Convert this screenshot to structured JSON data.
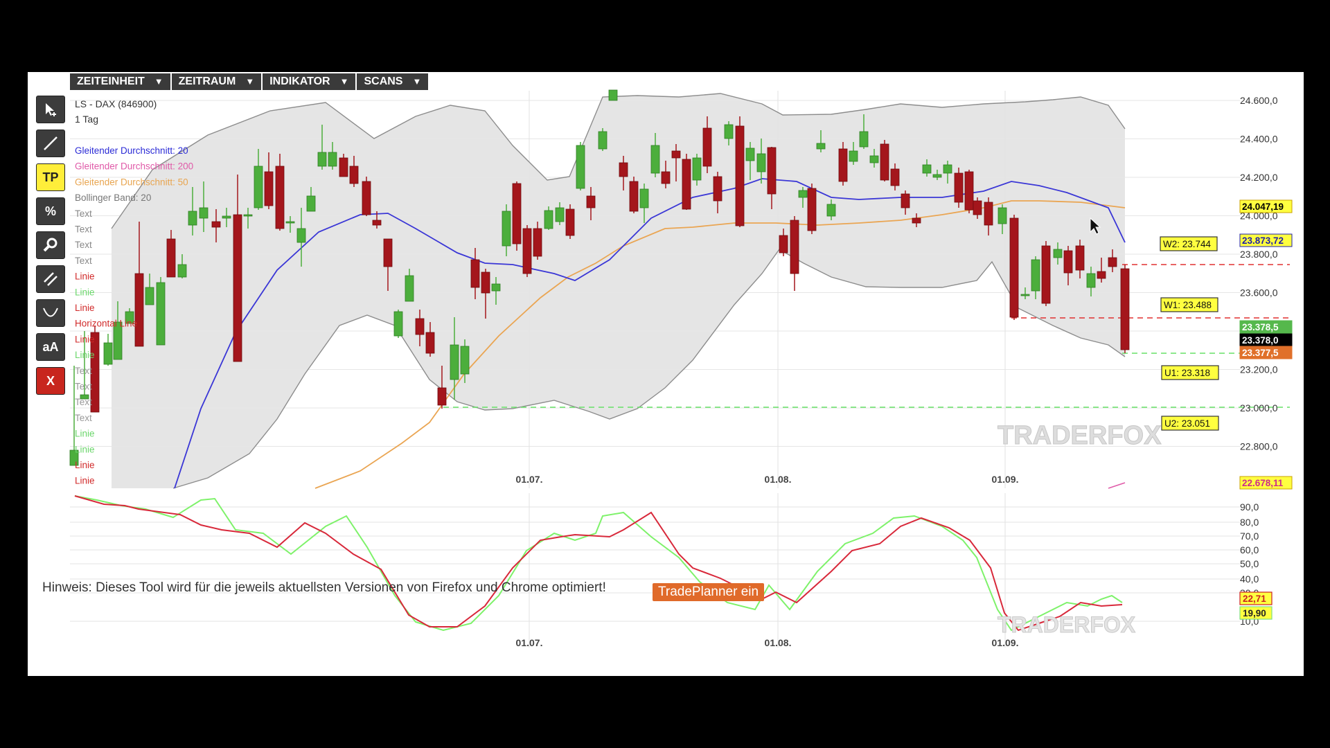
{
  "menu": [
    {
      "label": "ZEITEINHEIT"
    },
    {
      "label": "ZEITRAUM"
    },
    {
      "label": "INDIKATOR"
    },
    {
      "label": "SCANS"
    }
  ],
  "menu_arrow": "▼",
  "tools": {
    "pointer_icon": "cursor-arrow-icon",
    "line_icon": "trend-line-icon",
    "tp_label": "TP",
    "percent_label": "%",
    "zoom_icon": "magnifier-icon",
    "channel_icon": "parallel-lines-icon",
    "arc_icon": "arc-icon",
    "text_label": "aA",
    "close_label": "X"
  },
  "chart": {
    "instrument": "LS - DAX (846900)",
    "timeframe": "1 Tag",
    "legend": [
      {
        "text": "Gleitender Durchschnitt: 20",
        "color": "#2b2bd6"
      },
      {
        "text": "Gleitender Durchschnitt: 200",
        "color": "#e05aa8"
      },
      {
        "text": "Gleitender Durchschnitt: 50",
        "color": "#e8a550"
      },
      {
        "text": "Bollinger Band: 20",
        "color": "#777777"
      },
      {
        "text": "Text",
        "color": "#888888"
      },
      {
        "text": "Text",
        "color": "#888888"
      },
      {
        "text": "Text",
        "color": "#888888"
      },
      {
        "text": "Text",
        "color": "#888888"
      },
      {
        "text": "Linie",
        "color": "#d12a2a"
      },
      {
        "text": "Linie",
        "color": "#6bd66b"
      },
      {
        "text": "Linie",
        "color": "#d12a2a"
      },
      {
        "text": "Horizontal Line",
        "color": "#d12a2a"
      },
      {
        "text": "Linie",
        "color": "#d12a2a"
      },
      {
        "text": "Linie",
        "color": "#6bd66b"
      },
      {
        "text": "Text",
        "color": "#999999"
      },
      {
        "text": "Text",
        "color": "#999999"
      },
      {
        "text": "Text",
        "color": "#999999"
      },
      {
        "text": "Text",
        "color": "#999999"
      },
      {
        "text": "Linie",
        "color": "#6bd66b"
      },
      {
        "text": "Linie",
        "color": "#6bd66b"
      },
      {
        "text": "Linie",
        "color": "#d12a2a"
      },
      {
        "text": "Linie",
        "color": "#d12a2a"
      }
    ],
    "y_ticks": [
      "24.600,0",
      "24.400,0",
      "24.200,0",
      "24.000,0",
      "23.800,0",
      "23.600,0",
      "23.400,0",
      "23.200,0",
      "23.000,0",
      "22.800,0"
    ],
    "x_ticks": [
      "01.07.",
      "01.08.",
      "01.09."
    ],
    "price_tags": [
      {
        "text": "24.047,19",
        "bg": "#ffff40",
        "fg": "#000000",
        "border": "#c8a000"
      },
      {
        "text": "23.873,72",
        "bg": "#ffff40",
        "fg": "#1f1fa8",
        "border": "#1f1fa8"
      },
      {
        "text": "23.378,5",
        "bg": "#55b84c",
        "fg": "#ffffff",
        "border": "#55b84c"
      },
      {
        "text": "23.378,0",
        "bg": "#000000",
        "fg": "#ffffff",
        "border": "#000000"
      },
      {
        "text": "23.377,5",
        "bg": "#e0702a",
        "fg": "#ffffff",
        "border": "#e0702a"
      },
      {
        "text": "22.678,11",
        "bg": "#ffff40",
        "fg": "#cc2b8a",
        "border": "#c8a000"
      }
    ],
    "level_labels": [
      "W2: 23.744",
      "W1: 23.488",
      "U1: 23.318",
      "U2: 23.051"
    ],
    "watermark": "TRADERFOX"
  },
  "oscillator": {
    "y_ticks": [
      "90,0",
      "80,0",
      "70,0",
      "60,0",
      "50,0",
      "40,0",
      "30,0",
      "10,0"
    ],
    "x_ticks": [
      "01.07.",
      "01.08.",
      "01.09."
    ],
    "tags": [
      {
        "text": "22,71",
        "bg": "#ffff40",
        "fg": "#cc2020",
        "border": "#cc2020"
      },
      {
        "text": "19,90",
        "bg": "#ffff40",
        "fg": "#222222",
        "border": "#7fe07f"
      }
    ],
    "watermark": "TRADERFOX"
  },
  "colors": {
    "up": "#4cae3c",
    "down": "#a4161c",
    "ma20": "#3a36d6",
    "ma50": "#eaa552",
    "band": "#8c8c8c",
    "osc_green": "#7ef26a",
    "osc_red": "#d8283a",
    "dash_red": "#e03030",
    "dash_green": "#66e066"
  },
  "footer": {
    "note": "Hinweis: Dieses Tool wird für die jeweils aktuellsten Versionen von Firefox und Chrome optimiert!",
    "button": "TradePlanner ein"
  }
}
